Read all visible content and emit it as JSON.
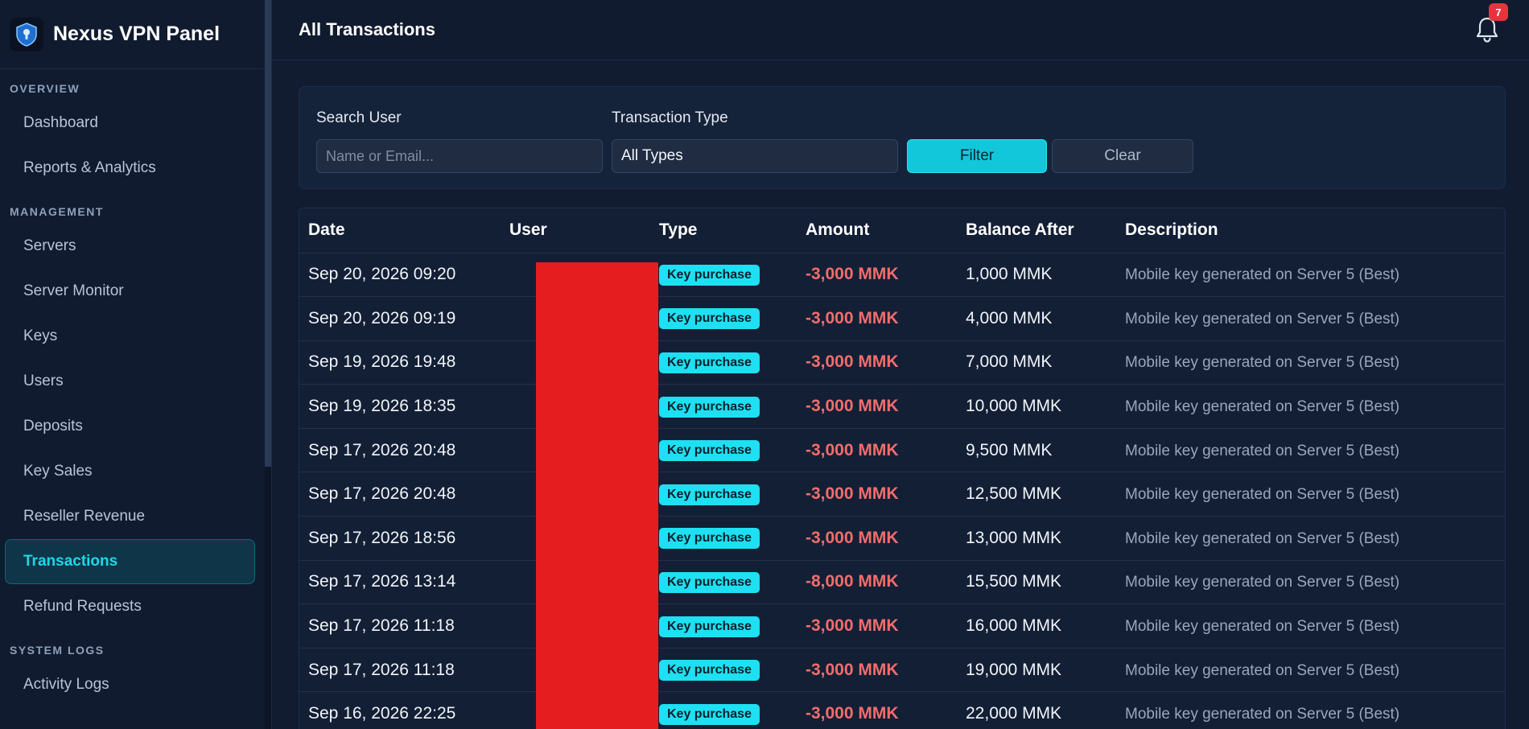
{
  "brand": {
    "title": "Nexus VPN Panel"
  },
  "nav": [
    {
      "section": "OVERVIEW",
      "items": [
        {
          "label": "Dashboard",
          "active": false
        },
        {
          "label": "Reports & Analytics",
          "active": false
        }
      ]
    },
    {
      "section": "MANAGEMENT",
      "items": [
        {
          "label": "Servers",
          "active": false
        },
        {
          "label": "Server Monitor",
          "active": false
        },
        {
          "label": "Keys",
          "active": false
        },
        {
          "label": "Users",
          "active": false
        },
        {
          "label": "Deposits",
          "active": false
        },
        {
          "label": "Key Sales",
          "active": false
        },
        {
          "label": "Reseller Revenue",
          "active": false
        },
        {
          "label": "Transactions",
          "active": true
        },
        {
          "label": "Refund Requests",
          "active": false
        }
      ]
    },
    {
      "section": "SYSTEM LOGS",
      "items": [
        {
          "label": "Activity Logs",
          "active": false
        }
      ]
    }
  ],
  "header": {
    "title": "All Transactions",
    "notifications": "7"
  },
  "filters": {
    "search_label": "Search User",
    "search_placeholder": "Name or Email...",
    "type_label": "Transaction Type",
    "type_value": "All Types",
    "filter_button": "Filter",
    "clear_button": "Clear"
  },
  "table": {
    "columns": [
      "Date",
      "User",
      "Type",
      "Amount",
      "Balance After",
      "Description"
    ],
    "rows": [
      {
        "date": "Sep 20, 2026 09:20",
        "user": "",
        "type": "Key purchase",
        "amount": "-3,000 MMK",
        "balance": "1,000 MMK",
        "description": "Mobile key generated on Server 5 (Best)"
      },
      {
        "date": "Sep 20, 2026 09:19",
        "user": "",
        "type": "Key purchase",
        "amount": "-3,000 MMK",
        "balance": "4,000 MMK",
        "description": "Mobile key generated on Server 5 (Best)"
      },
      {
        "date": "Sep 19, 2026 19:48",
        "user": "",
        "type": "Key purchase",
        "amount": "-3,000 MMK",
        "balance": "7,000 MMK",
        "description": "Mobile key generated on Server 5 (Best)"
      },
      {
        "date": "Sep 19, 2026 18:35",
        "user": "",
        "type": "Key purchase",
        "amount": "-3,000 MMK",
        "balance": "10,000 MMK",
        "description": "Mobile key generated on Server 5 (Best)"
      },
      {
        "date": "Sep 17, 2026 20:48",
        "user": "",
        "type": "Key purchase",
        "amount": "-3,000 MMK",
        "balance": "9,500 MMK",
        "description": "Mobile key generated on Server 5 (Best)"
      },
      {
        "date": "Sep 17, 2026 20:48",
        "user": "",
        "type": "Key purchase",
        "amount": "-3,000 MMK",
        "balance": "12,500 MMK",
        "description": "Mobile key generated on Server 5 (Best)"
      },
      {
        "date": "Sep 17, 2026 18:56",
        "user": "",
        "type": "Key purchase",
        "amount": "-3,000 MMK",
        "balance": "13,000 MMK",
        "description": "Mobile key generated on Server 5 (Best)"
      },
      {
        "date": "Sep 17, 2026 13:14",
        "user": "",
        "type": "Key purchase",
        "amount": "-8,000 MMK",
        "balance": "15,500 MMK",
        "description": "Mobile key generated on Server 5 (Best)"
      },
      {
        "date": "Sep 17, 2026 11:18",
        "user": "",
        "type": "Key purchase",
        "amount": "-3,000 MMK",
        "balance": "16,000 MMK",
        "description": "Mobile key generated on Server 5 (Best)"
      },
      {
        "date": "Sep 17, 2026 11:18",
        "user": "",
        "type": "Key purchase",
        "amount": "-3,000 MMK",
        "balance": "19,000 MMK",
        "description": "Mobile key generated on Server 5 (Best)"
      },
      {
        "date": "Sep 16, 2026 22:25",
        "user": "",
        "type": "Key purchase",
        "amount": "-3,000 MMK",
        "balance": "22,000 MMK",
        "description": "Mobile key generated on Server 5 (Best)"
      }
    ]
  },
  "colors": {
    "accent": "#1fd6e8",
    "negative": "#f26d6d",
    "badge": "#e5343c",
    "redaction": "#e51d1f"
  }
}
